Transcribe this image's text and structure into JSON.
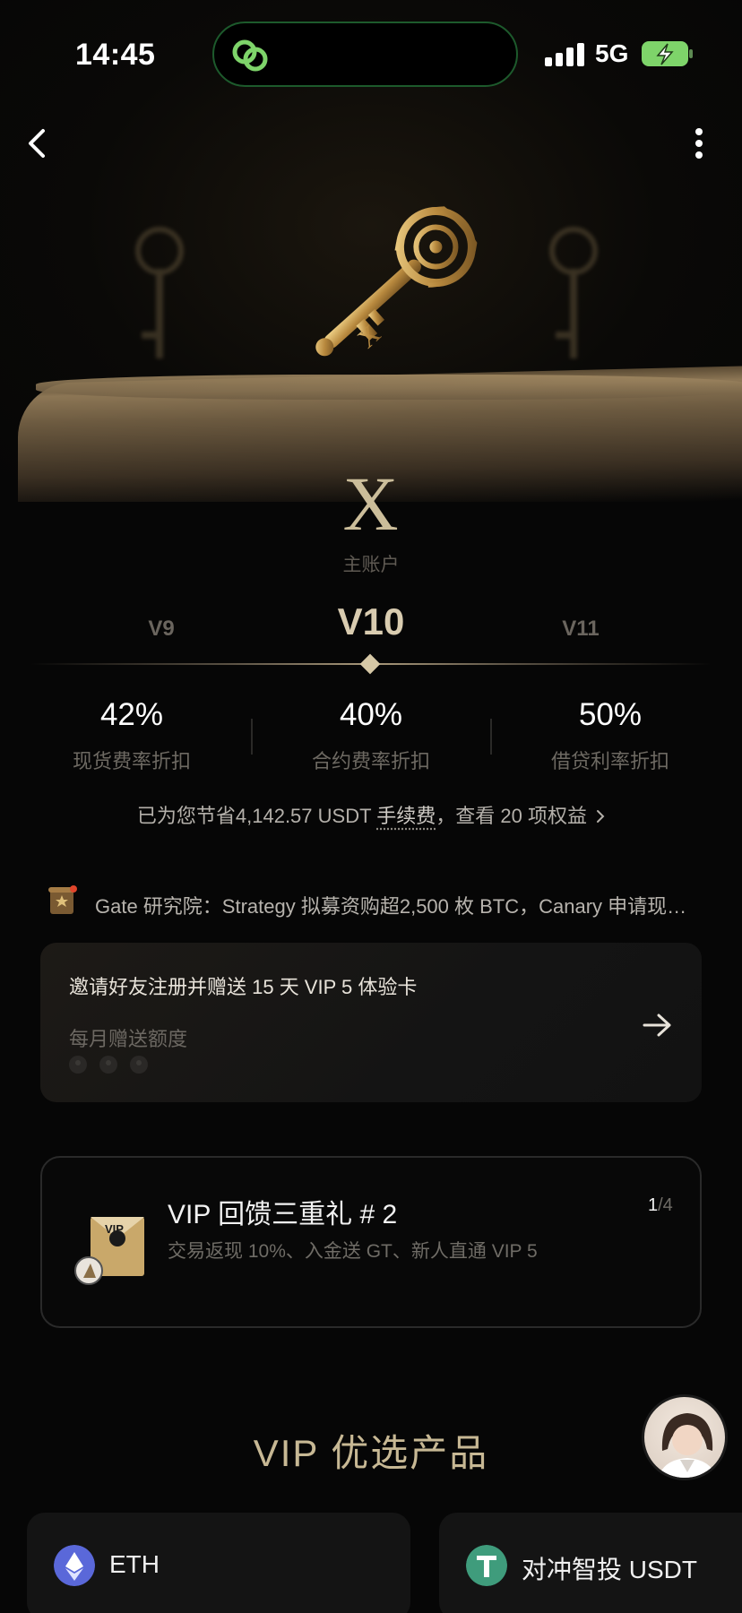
{
  "status_bar": {
    "time": "14:45",
    "network": "5G"
  },
  "hero": {
    "tier_letter": "X",
    "account_label": "主账户"
  },
  "levels": {
    "previous": "V9",
    "current": "V10",
    "next": "V11"
  },
  "rates": [
    {
      "value": "42%",
      "label": "现货费率折扣"
    },
    {
      "value": "40%",
      "label": "合约费率折扣"
    },
    {
      "value": "50%",
      "label": "借贷利率折扣"
    }
  ],
  "savings": {
    "prefix": "已为您节省",
    "amount": "4,142.57 USDT",
    "fee_label": "手续费",
    "suffix": "，查看 20 项权益"
  },
  "ticker": {
    "text": "Gate 研究院：Strategy 拟募资购超2,500 枚 BTC，Canary 申请现…"
  },
  "invite": {
    "title": "邀请好友注册并赠送 15 天 VIP 5 体验卡",
    "subtitle": "每月赠送额度"
  },
  "gift": {
    "title": "VIP 回馈三重礼 # 2",
    "subtitle": "交易返现 10%、入金送 GT、新人直通 VIP 5",
    "badge": "VIP",
    "page_current": "1",
    "page_total": "/4"
  },
  "section": {
    "title": "VIP 优选产品"
  },
  "products": [
    {
      "name": "ETH"
    },
    {
      "name": "对冲智投 USDT"
    }
  ],
  "colors": {
    "gold": "#cbbd9a",
    "background": "#060606",
    "island_ring": "#1d5a2c",
    "battery": "#7ed46a"
  }
}
